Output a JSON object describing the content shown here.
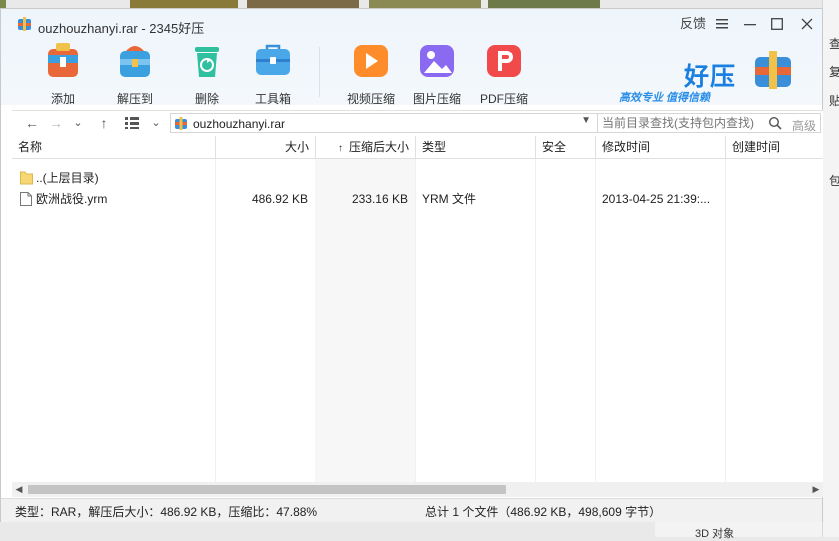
{
  "window": {
    "title": "ouzhouzhanyi.rar - 2345好压",
    "feedback_label": "反馈"
  },
  "toolbar": {
    "add": "添加",
    "extract": "解压到",
    "delete": "删除",
    "toolbox": "工具箱",
    "video": "视频压缩",
    "image": "图片压缩",
    "pdf": "PDF压缩"
  },
  "logo": {
    "name": "好压",
    "slogan": "高效专业 值得信赖"
  },
  "nav": {
    "address": "ouzhouzhanyi.rar",
    "search_placeholder": "当前目录查找(支持包内查找)",
    "advanced_label": "高级"
  },
  "columns": {
    "name": "名称",
    "size": "大小",
    "packed": "压缩后大小",
    "type": "类型",
    "security": "安全",
    "modified": "修改时间",
    "created": "创建时间"
  },
  "files": [
    {
      "name": "..(上层目录)",
      "size": "",
      "packed": "",
      "type": "",
      "security": "",
      "modified": "",
      "icon": "folder-icon"
    },
    {
      "name": "欧洲战役.yrm",
      "size": "486.92 KB",
      "packed": "233.16 KB",
      "type": "YRM 文件",
      "security": "",
      "modified": "2013-04-25 21:39:...",
      "icon": "file-icon"
    }
  ],
  "status": {
    "left": "类型：RAR，解压后大小：486.92 KB，压缩比：47.88%",
    "right": "总计 1 个文件（486.92 KB，498,609 字节）"
  },
  "background": {
    "right_labels": [
      "查",
      "复",
      "贴",
      "包"
    ],
    "bottom_label": "3D 对象"
  },
  "colors": {
    "accent": "#1a7fe0",
    "add": "#e9683a",
    "extract": "#3aa0e0",
    "delete": "#2fc0a0",
    "toolbox": "#4aa8e8",
    "video": "#ff8c2a",
    "image": "#8a6af0",
    "pdf": "#f04a4a"
  }
}
